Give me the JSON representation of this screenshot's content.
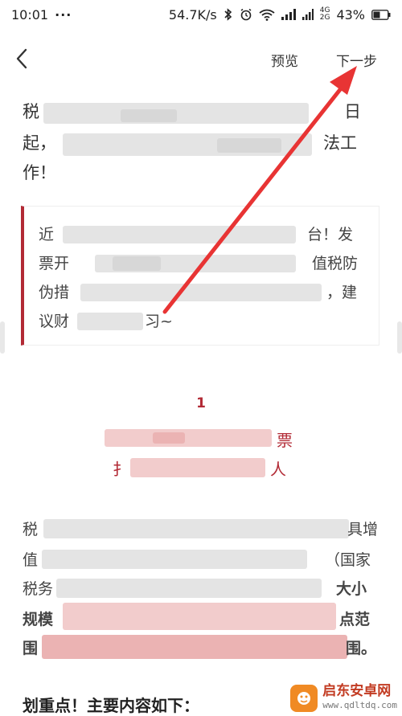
{
  "status_bar": {
    "time": "10:01",
    "dots": "···",
    "speed": "54.7K/s",
    "net_top": "4G",
    "net_bottom": "2G",
    "battery": "43%"
  },
  "nav": {
    "preview": "预览",
    "next": "下一步"
  },
  "para1": {
    "l1_start": "税",
    "l1_end": "日",
    "l2_start": "起，",
    "l2_end": "法工",
    "l3": "作！"
  },
  "quote": {
    "l1_start": "近",
    "l1_end": "台！发",
    "l2_start": "票开",
    "l2_end": "值税防",
    "l3_start": "伪措",
    "l3_end": "，建",
    "l4_start": "议财",
    "l4_end": "习~"
  },
  "section": {
    "number": "1",
    "t1_end": "票",
    "t2_start": "扌",
    "t2_end": "人"
  },
  "para2": {
    "l1_start": "税",
    "l1_end": "具增",
    "l2_start": "值",
    "l2_end": "（国家",
    "l3_start": "税务",
    "l3_end": "大小",
    "l4_start": "规模",
    "l4_end": "点范",
    "l5_start": "围",
    "l5_end": "围。"
  },
  "heading": "划重点！主要内容如下：",
  "watermark": {
    "name": "启东安卓网",
    "url": "www.qdltdq.com"
  },
  "colors": {
    "accent": "#b22a35",
    "arrow": "#e83434"
  }
}
